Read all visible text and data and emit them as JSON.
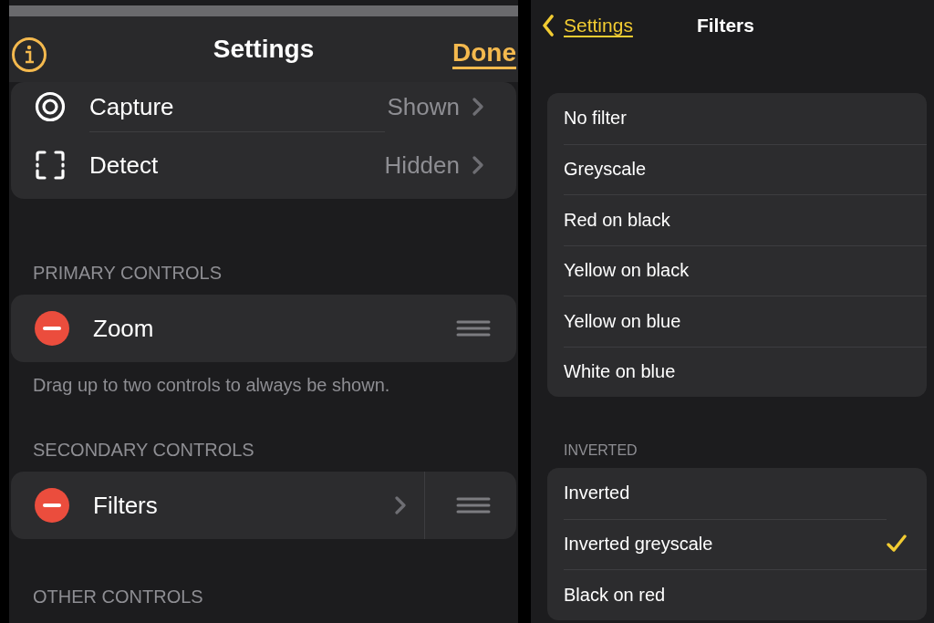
{
  "settings_screen": {
    "header": {
      "title": "Settings",
      "done": "Done"
    },
    "top_rows": [
      {
        "label": "Capture",
        "value": "Shown"
      },
      {
        "label": "Detect",
        "value": "Hidden"
      }
    ],
    "sections": [
      {
        "header": "PRIMARY CONTROLS",
        "rows": [
          {
            "label": "Zoom",
            "chevron": false
          }
        ],
        "footer": "Drag up to two controls to always be shown."
      },
      {
        "header": "SECONDARY CONTROLS",
        "rows": [
          {
            "label": "Filters",
            "chevron": true
          }
        ]
      },
      {
        "header": "OTHER CONTROLS"
      }
    ]
  },
  "filters_screen": {
    "nav": {
      "back": "Settings",
      "title": "Filters"
    },
    "groups": [
      {
        "items": [
          {
            "label": "No filter",
            "selected": false
          },
          {
            "label": "Greyscale",
            "selected": false
          },
          {
            "label": "Red on black",
            "selected": false
          },
          {
            "label": "Yellow on black",
            "selected": false
          },
          {
            "label": "Yellow on blue",
            "selected": false
          },
          {
            "label": "White on blue",
            "selected": false
          }
        ]
      },
      {
        "header": "INVERTED",
        "items": [
          {
            "label": "Inverted",
            "selected": false
          },
          {
            "label": "Inverted greyscale",
            "selected": true
          },
          {
            "label": "Black on red",
            "selected": false
          }
        ]
      }
    ]
  }
}
